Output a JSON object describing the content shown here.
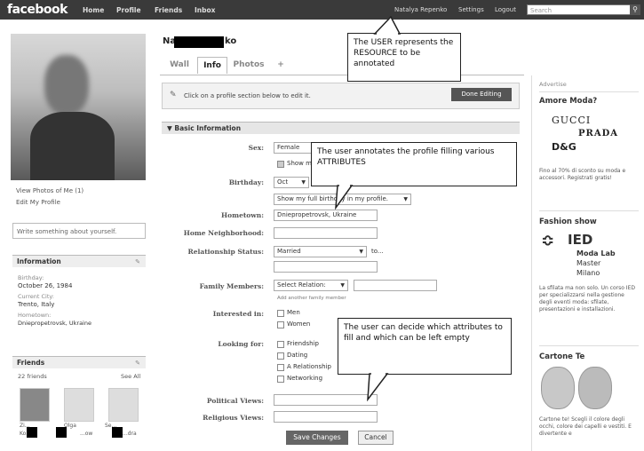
{
  "topbar": {
    "logo": "facebook",
    "nav": [
      "Home",
      "Profile",
      "Friends",
      "Inbox"
    ],
    "user": "Natalya Repenko",
    "settings": "Settings",
    "logout": "Logout",
    "search_placeholder": "Search"
  },
  "left": {
    "view_photos": "View Photos of Me (1)",
    "edit_profile": "Edit My Profile",
    "write_about": "Write something about yourself.",
    "info_head": "Information",
    "birthday_label": "Birthday:",
    "birthday_value": "October 26, 1984",
    "city_label": "Current City:",
    "city_value": "Trento, Italy",
    "hometown_label": "Hometown:",
    "hometown_value": "Dniepropetrovsk, Ukraine",
    "friends_head": "Friends",
    "friends_count": "22 friends",
    "see_all": "See All",
    "friend_names": [
      "Zi...",
      "Olga",
      "Se..."
    ],
    "friend_names2": [
      "Ko...",
      "...ow",
      "...dra"
    ]
  },
  "profile": {
    "name_start": "Na",
    "name_end": "ko",
    "tabs": [
      "Wall",
      "Info",
      "Photos",
      "+"
    ],
    "edit_hint": "Click on a profile section below to edit it.",
    "done_editing": "Done Editing",
    "section": "Basic Information"
  },
  "form": {
    "sex_label": "Sex:",
    "sex_value": "Female",
    "show_sex": "Show my...",
    "birthday_label": "Birthday:",
    "birthday_month": "Oct",
    "show_birthday": "Show my full birthday in my profile.",
    "hometown_label": "Hometown:",
    "hometown_value": "Dniepropetrovsk, Ukraine",
    "neighborhood_label": "Home Neighborhood:",
    "relationship_label": "Relationship Status:",
    "relationship_value": "Married",
    "relationship_to": "to...",
    "family_label": "Family Members:",
    "family_select": "Select Relation:",
    "family_hint": "Add another family member",
    "interested_label": "Interested in:",
    "interested": [
      "Men",
      "Women"
    ],
    "looking_label": "Looking for:",
    "looking": [
      "Friendship",
      "Dating",
      "A Relationship",
      "Networking"
    ],
    "political_label": "Political Views:",
    "religious_label": "Religious Views:",
    "save": "Save Changes",
    "cancel": "Cancel"
  },
  "callouts": {
    "user": "The USER represents the RESOURCE to be annotated",
    "attributes": "The user annotates the profile filling various ATTRIBUTES",
    "decide": "The user can decide which attributes to fill and which can be left empty"
  },
  "ads": {
    "advertise": "Advertise",
    "ad1_title": "Amore Moda?",
    "gucci": "GUCCI",
    "prada": "PRADA",
    "dg": "D&G",
    "ad1_text": "Fino al 70% di sconto su moda e accessori. Registrati gratis!",
    "ad2_title": "Fashion show",
    "ied": "IED",
    "ied_sub": [
      "Moda Lab",
      "Master",
      "Milano"
    ],
    "ad2_text": "La sfilata ma non solo. Un corso IED per specializzarsi nella gestione degli eventi moda: sfilate, presentazioni e installazioni.",
    "ad3_title": "Cartone Te",
    "ad3_text": "Cartone te! Scegli il colore degli occhi, colore dei capelli e vestiti. E divertente e"
  }
}
